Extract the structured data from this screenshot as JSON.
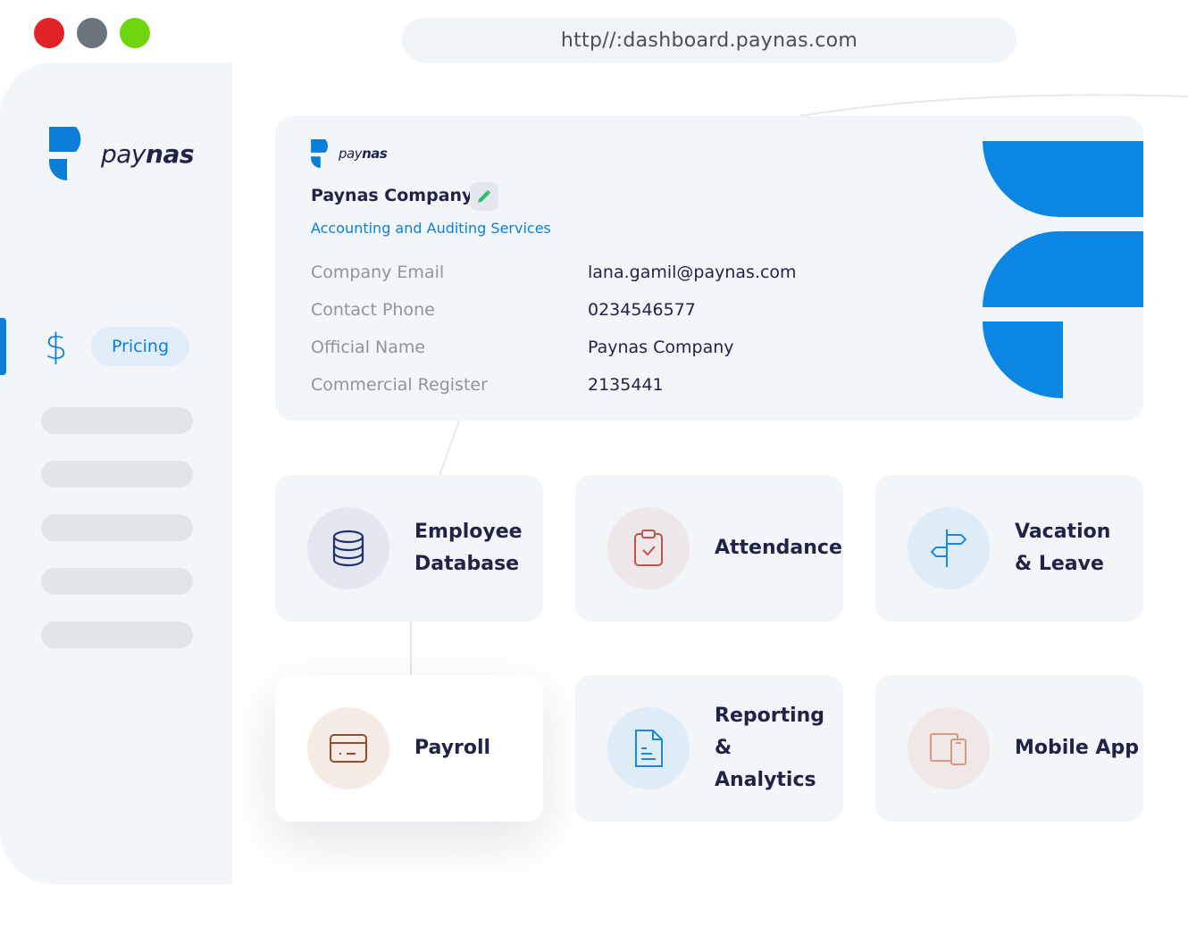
{
  "window": {
    "controls": [
      "close",
      "minimize",
      "maximize"
    ],
    "url": "http//:dashboard.paynas.com"
  },
  "brand": {
    "name_light": "pay",
    "name_bold": "nas",
    "color": "#0b7fd8"
  },
  "sidebar": {
    "active_item": {
      "icon": "dollar-icon",
      "label": "Pricing"
    }
  },
  "company": {
    "name": "Paynas Company",
    "category": "Accounting and Auditing Services",
    "fields": [
      {
        "label": "Company Email",
        "value": "lana.gamil@paynas.com"
      },
      {
        "label": "Contact Phone",
        "value": "0234546577"
      },
      {
        "label": "Official Name",
        "value": "Paynas Company"
      },
      {
        "label": "Commercial Register",
        "value": "2135441"
      }
    ]
  },
  "modules": [
    {
      "label": "Employee\nDatabase",
      "icon": "database-icon"
    },
    {
      "label": "Attendance",
      "icon": "clipboard-check-icon"
    },
    {
      "label": "Vacation\n& Leave",
      "icon": "signpost-icon"
    },
    {
      "label": "Payroll",
      "icon": "credit-card-icon"
    },
    {
      "label": "Reporting\n& Analytics",
      "icon": "document-icon"
    },
    {
      "label": "Mobile App",
      "icon": "devices-icon"
    }
  ]
}
